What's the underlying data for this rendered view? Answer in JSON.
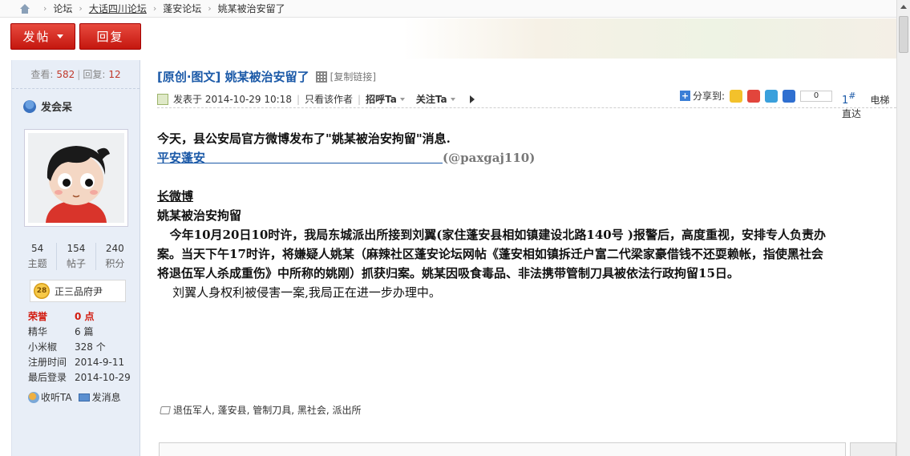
{
  "breadcrumb": {
    "items": [
      "论坛",
      "大话四川论坛",
      "蓬安论坛",
      "姚某被治安留了"
    ]
  },
  "toolbar": {
    "post_label": "发帖",
    "reply_label": "回复"
  },
  "user": {
    "views_label": "查看:",
    "views": "582",
    "replies_label": "回复:",
    "replies": "12",
    "name": "发会呆",
    "stats": [
      {
        "value": "54",
        "label": "主题"
      },
      {
        "value": "154",
        "label": "帖子"
      },
      {
        "value": "240",
        "label": "积分"
      }
    ],
    "rank_level": "28",
    "rank_title": "正三品府尹",
    "info": [
      {
        "key": "荣誉",
        "value": "0 点"
      },
      {
        "key": "精华",
        "value": "6 篇"
      },
      {
        "key": "小米椒",
        "value": "328 个"
      },
      {
        "key": "注册时间",
        "value": "2014-9-11"
      },
      {
        "key": "最后登录",
        "value": "2014-10-29"
      }
    ],
    "follow_label": "收听TA",
    "message_label": "发消息"
  },
  "post": {
    "title": "[原创·图文] 姚某被治安留了",
    "copy_link": "[复制链接]",
    "posted_prefix": "发表于 2014-10-29 10:18",
    "only_author": "只看该作者",
    "greet": "招呼Ta",
    "follow": "关注Ta",
    "share_label": "分享到:",
    "share_count": "0",
    "floor_number": "1",
    "floor_hash": "#",
    "lift_label": "电梯直达",
    "lines": {
      "l1": "今天，县公安局官方微博发布了\"姚某被治安拘留\"消息.",
      "l2_link": "平安蓬安",
      "l2_handle": "(@paxgaj110)",
      "l3": "长微博",
      "l4": "姚某被治安拘留",
      "l5": "   今年10月20日10时许，我局东城派出所接到刘翼(家住蓬安县相如镇建设北路140号 )报警后，高度重视，安排专人负责办",
      "l6": "案。当天下午17时许，将嫌疑人姚某（麻辣社区蓬安论坛网帖《蓬安相如镇拆迁户富二代梁家豪借钱不还耍赖帐，指使黑社会",
      "l7": "将退伍军人杀成重伤》中所称的姚刚）抓获归案。姚某因吸食毒品、非法携带管制刀具被依法行政拘留15日。",
      "l8": "    刘翼人身权利被侵害一案,我局正在进一步办理中。"
    },
    "tags": "退伍军人, 蓬安县, 管制刀具, 黑社会, 派出所"
  },
  "colors": {
    "accent_red": "#c4170f",
    "link_blue": "#1c5aa8",
    "sidebar_bg": "#e8eef7"
  }
}
